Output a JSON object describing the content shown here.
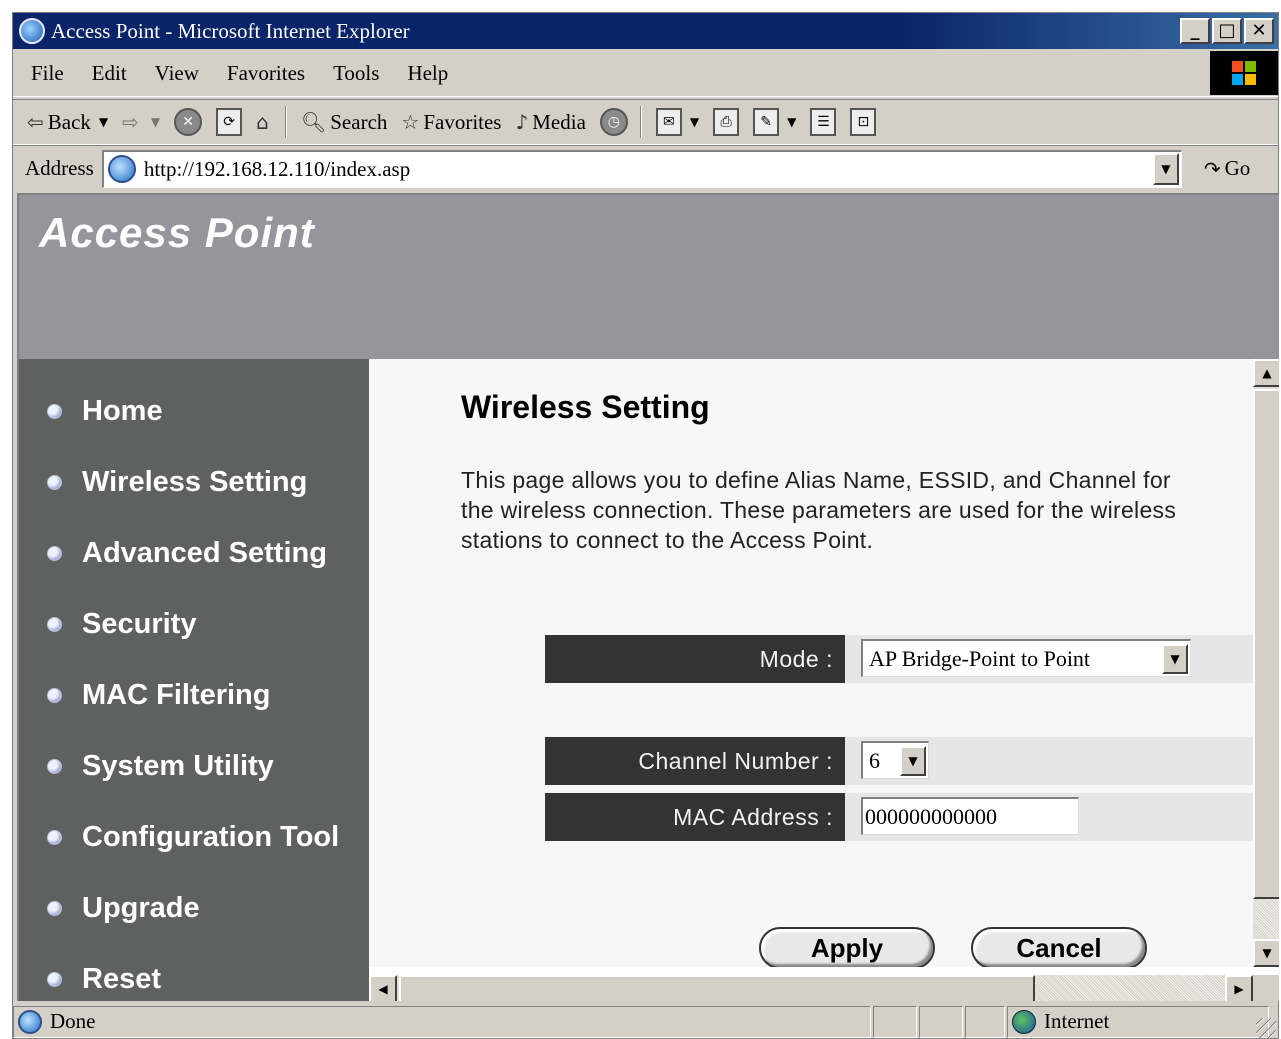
{
  "window": {
    "title": "Access Point - Microsoft Internet Explorer",
    "minimize": "_",
    "maximize": "□",
    "close": "✕"
  },
  "menu": [
    "File",
    "Edit",
    "View",
    "Favorites",
    "Tools",
    "Help"
  ],
  "toolbar": {
    "back": "Back",
    "search": "Search",
    "favorites": "Favorites",
    "media": "Media"
  },
  "address": {
    "label": "Address",
    "url": "http://192.168.12.110/index.asp",
    "go": "Go"
  },
  "banner": {
    "title": "Access Point"
  },
  "sidebar": {
    "items": [
      {
        "label": "Home"
      },
      {
        "label": "Wireless Setting"
      },
      {
        "label": "Advanced Setting"
      },
      {
        "label": "Security"
      },
      {
        "label": "MAC Filtering"
      },
      {
        "label": "System Utility"
      },
      {
        "label": "Configuration Tool"
      },
      {
        "label": "Upgrade"
      },
      {
        "label": "Reset"
      }
    ]
  },
  "main": {
    "heading": "Wireless Setting",
    "description": "This page allows you to define Alias Name, ESSID, and Channel for the wireless connection. These parameters are used for the wireless stations to connect to the Access Point.",
    "mode": {
      "label": "Mode :",
      "value": "AP Bridge-Point to Point"
    },
    "channel": {
      "label": "Channel Number :",
      "value": "6"
    },
    "mac": {
      "label": "MAC Address :",
      "value": "000000000000"
    },
    "apply": "Apply",
    "cancel": "Cancel"
  },
  "status": {
    "text": "Done",
    "zone": "Internet"
  }
}
